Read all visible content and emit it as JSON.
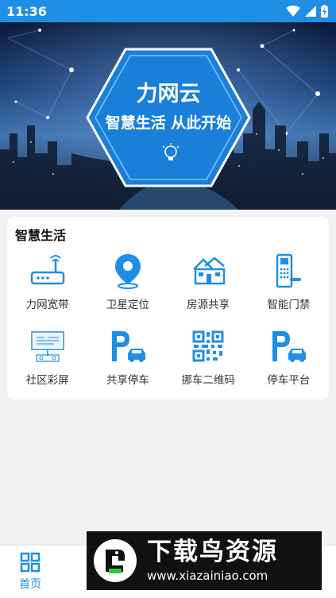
{
  "status_bar": {
    "time": "11:36"
  },
  "banner": {
    "title": "力网云",
    "slogan": "智慧生活 从此开始"
  },
  "smart_life": {
    "title": "智慧生活",
    "items": [
      {
        "label": "力网宽带",
        "icon": "router-icon"
      },
      {
        "label": "卫星定位",
        "icon": "location-pin-icon"
      },
      {
        "label": "房源共享",
        "icon": "house-icon"
      },
      {
        "label": "智能门禁",
        "icon": "door-access-icon"
      },
      {
        "label": "社区彩屏",
        "icon": "community-screen-icon"
      },
      {
        "label": "共享停车",
        "icon": "parking-car-icon"
      },
      {
        "label": "挪车二维码",
        "icon": "qr-code-icon"
      },
      {
        "label": "停车平台",
        "icon": "parking-car-icon"
      }
    ]
  },
  "tab_bar": {
    "home_label": "首页"
  },
  "watermark": {
    "title": "下载鸟资源",
    "url": "www.xiazainiao.com"
  },
  "colors": {
    "primary": "#1f8fe6",
    "text": "#333333",
    "background": "#f2f2f2"
  }
}
